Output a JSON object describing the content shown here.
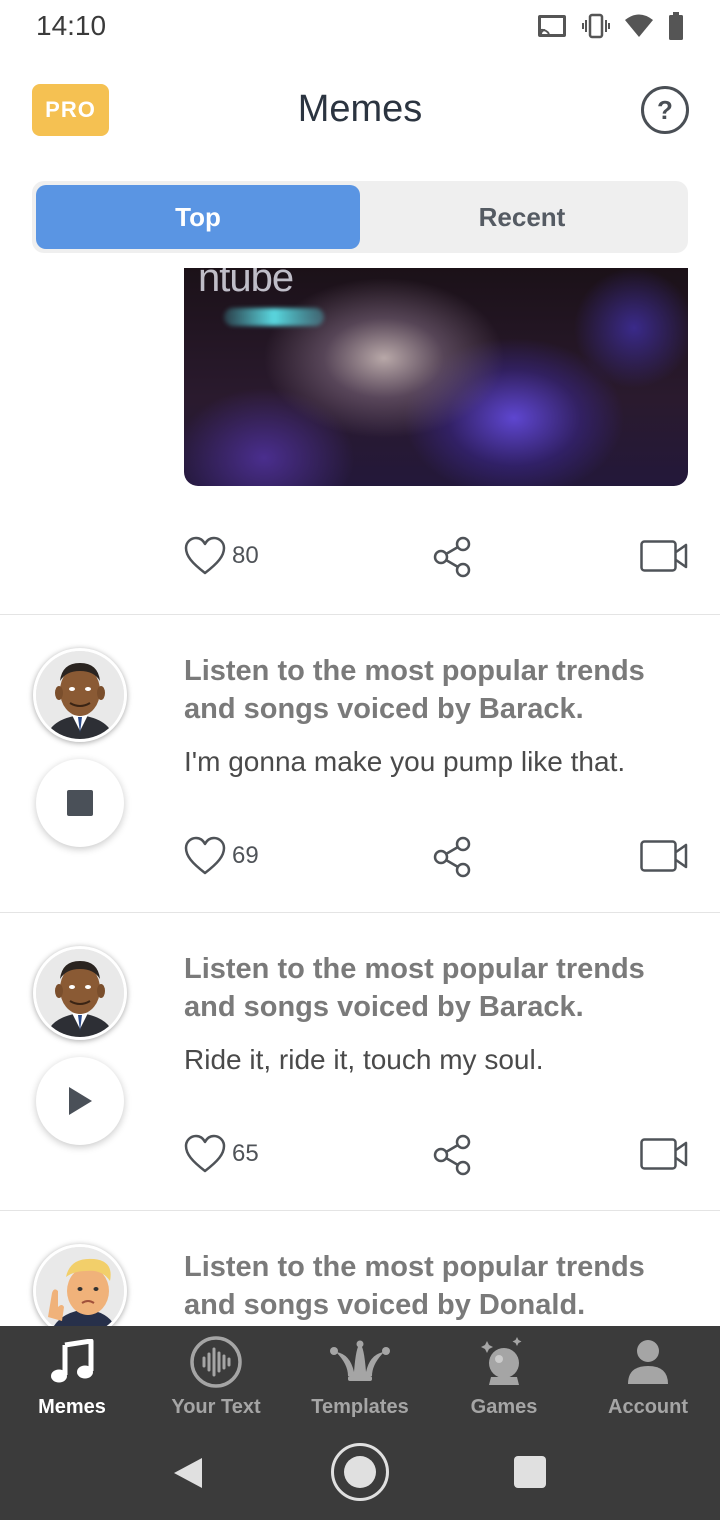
{
  "status_bar": {
    "time": "14:10",
    "icons": [
      "cast-icon",
      "vibrate-icon",
      "wifi-icon",
      "battery-icon"
    ]
  },
  "header": {
    "pro_label": "PRO",
    "title": "Memes",
    "help_label": "?"
  },
  "tabs": {
    "top_label": "Top",
    "recent_label": "Recent",
    "active": "Top"
  },
  "feed": {
    "video_post": {
      "watermark": "ntube",
      "likes": "80"
    },
    "posts": [
      {
        "title": "Listen to the most popular trends and songs voiced by Barack.",
        "text": "I'm gonna make you pump like that.",
        "likes": "69",
        "state": "stop",
        "character": "barack"
      },
      {
        "title": "Listen to the most popular trends and songs voiced by Barack.",
        "text": "Ride it, ride it, touch my soul.",
        "likes": "65",
        "state": "play",
        "character": "barack"
      },
      {
        "title": "Listen to the most popular trends and songs voiced by Donald.",
        "text": "",
        "likes": "",
        "state": "play",
        "character": "donald"
      }
    ]
  },
  "bottom_nav": {
    "items": [
      {
        "label": "Memes",
        "icon": "music-note-icon",
        "active": true
      },
      {
        "label": "Your Text",
        "icon": "voice-wave-icon",
        "active": false
      },
      {
        "label": "Templates",
        "icon": "jester-hat-icon",
        "active": false
      },
      {
        "label": "Games",
        "icon": "crystal-ball-icon",
        "active": false
      },
      {
        "label": "Account",
        "icon": "user-icon",
        "active": false
      }
    ]
  },
  "colors": {
    "accent": "#5a95e3",
    "pro": "#f5c152",
    "nav_bg": "#3b3b3b"
  }
}
